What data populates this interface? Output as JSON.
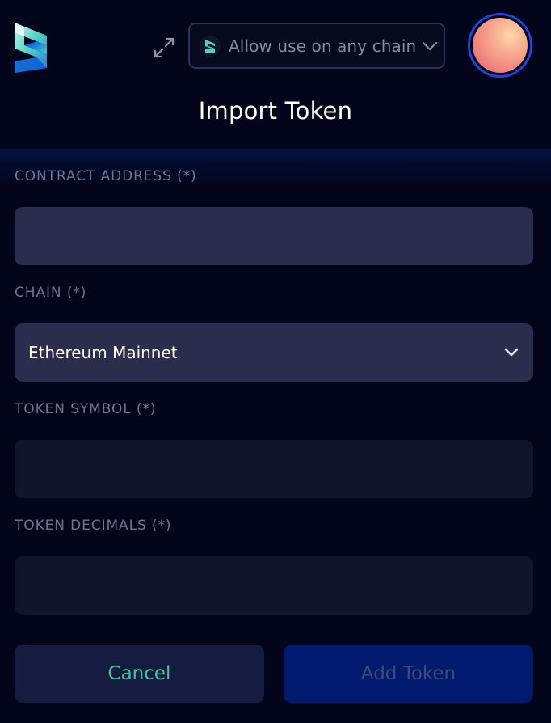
{
  "header": {
    "logo_icon": "subwallet-logo-icon",
    "expand_icon": "expand-arrows-icon",
    "chain_filter": {
      "label": "Allow use on any chain",
      "icon": "chain-logo-icon",
      "chevron_icon": "chevron-down-icon"
    },
    "avatar_icon": "account-avatar"
  },
  "page": {
    "title": "Import Token"
  },
  "form": {
    "contract_address": {
      "label": "CONTRACT ADDRESS (*)",
      "value": ""
    },
    "chain": {
      "label": "CHAIN (*)",
      "value": "Ethereum Mainnet",
      "chevron_icon": "chevron-down-icon"
    },
    "token_symbol": {
      "label": "TOKEN SYMBOL (*)",
      "value": ""
    },
    "token_decimals": {
      "label": "TOKEN DECIMALS (*)",
      "value": ""
    }
  },
  "actions": {
    "cancel_label": "Cancel",
    "add_label": "Add Token"
  },
  "colors": {
    "background": "#03061a",
    "input_active": "#2a2d4b",
    "input_idle": "#11142b",
    "cancel_text": "#3fc7a0",
    "add_button_bg": "#001a6e",
    "avatar_ring": "#1d45e0"
  }
}
